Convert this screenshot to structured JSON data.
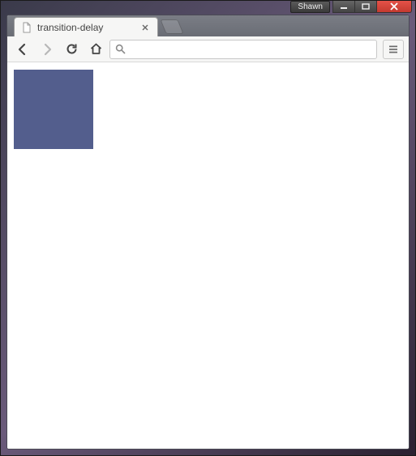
{
  "window": {
    "user_badge": "Shawn"
  },
  "tab": {
    "title": "transition-delay"
  },
  "omnibox": {
    "value": "",
    "placeholder": ""
  },
  "content": {
    "square_color": "#535e8d"
  }
}
